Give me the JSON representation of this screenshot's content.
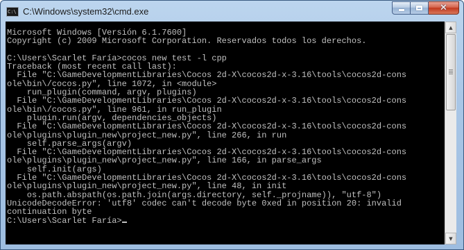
{
  "window": {
    "title": "C:\\Windows\\system32\\cmd.exe",
    "app_icon": "cmd-icon",
    "icon_text": "C:\\",
    "controls": {
      "minimize_icon": "minimize-icon",
      "maximize_icon": "maximize-icon",
      "close_icon": "close-icon",
      "close_glyph": "✕"
    }
  },
  "console": {
    "colors": {
      "background": "#000000",
      "text": "#c0c0c0"
    },
    "lines": [
      "Microsoft Windows [Versión 6.1.7600]",
      "Copyright (c) 2009 Microsoft Corporation. Reservados todos los derechos.",
      "",
      "C:\\Users\\Scarlet Faría>cocos new test -l cpp",
      "Traceback (most recent call last):",
      "  File \"C:\\GameDevelopmentLibraries\\Cocos 2d-X\\cocos2d-x-3.16\\tools\\cocos2d-cons",
      "ole\\bin\\/cocos.py\", line 1072, in <module>",
      "    run_plugin(command, argv, plugins)",
      "  File \"C:\\GameDevelopmentLibraries\\Cocos 2d-X\\cocos2d-x-3.16\\tools\\cocos2d-cons",
      "ole\\bin\\/cocos.py\", line 961, in run_plugin",
      "    plugin.run(argv, dependencies_objects)",
      "  File \"C:\\GameDevelopmentLibraries\\Cocos 2d-X\\cocos2d-x-3.16\\tools\\cocos2d-cons",
      "ole\\plugins\\plugin_new\\project_new.py\", line 266, in run",
      "    self.parse_args(argv)",
      "  File \"C:\\GameDevelopmentLibraries\\Cocos 2d-X\\cocos2d-x-3.16\\tools\\cocos2d-cons",
      "ole\\plugins\\plugin_new\\project_new.py\", line 166, in parse_args",
      "    self.init(args)",
      "  File \"C:\\GameDevelopmentLibraries\\Cocos 2d-X\\cocos2d-x-3.16\\tools\\cocos2d-cons",
      "ole\\plugins\\plugin_new\\project_new.py\", line 48, in init",
      "    os.path.abspath(os.path.join(args.directory, self._projname)), \"utf-8\")",
      "UnicodeDecodeError: 'utf8' codec can't decode byte 0xed in position 20: invalid",
      "continuation byte"
    ],
    "prompt": "C:\\Users\\Scarlet Faría>",
    "input_value": ""
  },
  "scrollbar": {
    "up_icon": "scroll-up-arrow-icon",
    "down_icon": "scroll-down-arrow-icon",
    "up_glyph": "▲",
    "down_glyph": "▼"
  }
}
